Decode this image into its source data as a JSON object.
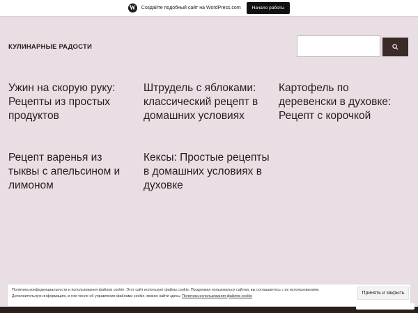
{
  "topbar": {
    "logo_glyph": "W",
    "text": "Создайте подобный сайт на WordPress.com",
    "button_label": "Начало работы"
  },
  "header": {
    "site_title": "КУЛИНАРНЫЕ РАДОСТИ",
    "search_value": "",
    "search_icon": "search-icon"
  },
  "posts": [
    {
      "title": "Ужин на скорую руку: Рецепты из простых продуктов"
    },
    {
      "title": "Штрудель с яблоками: классический рецепт в домашних условиях"
    },
    {
      "title": "Картофель по деревенски в духовке: Рецепт с корочкой"
    },
    {
      "title": "Рецепт варенья из тыквы с апельсином и лимоном"
    },
    {
      "title": "Кексы: Простые рецепты в домашних условиях в духовке"
    }
  ],
  "cookie_banner": {
    "line1": "Политика конфиденциальности и использования файлов cookie: Этот сайт использует файлы cookie. Продолжая пользоваться сайтом, вы соглашаетесь с их использованием.",
    "line2_prefix": "Дополнительную информацию, в том числе об управлении файлами cookie, можно найти здесь: ",
    "link_text": "Политика использования файлов cookie",
    "accept_label": "Принять и закрыть"
  },
  "colors": {
    "background": "#e8dee3",
    "text": "#2a1c1c",
    "accent_dark": "#3a2a28"
  }
}
